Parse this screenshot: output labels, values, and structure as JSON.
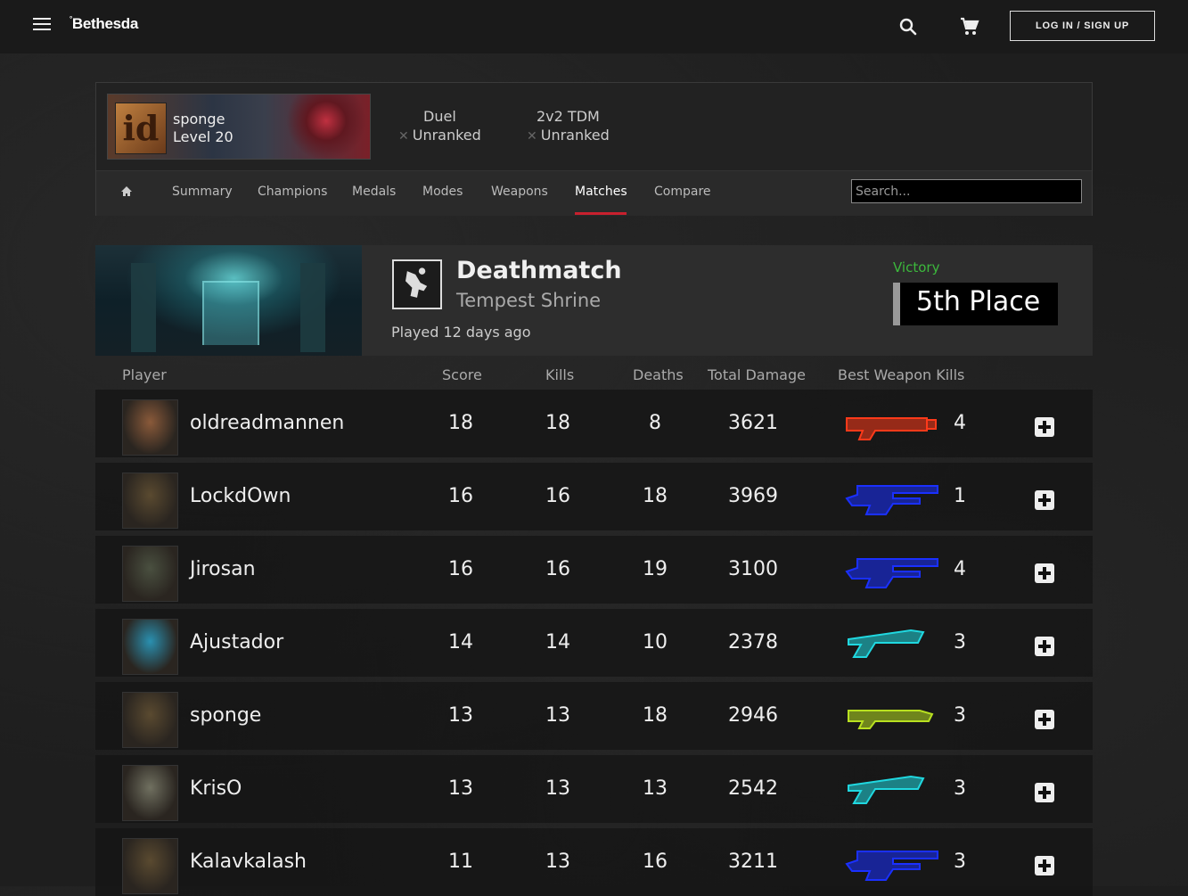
{
  "header": {
    "logo": "Bethesda",
    "logo_mark": "°",
    "login_label": "LOG IN / SIGN UP"
  },
  "profile": {
    "name": "sponge",
    "level": "Level 20",
    "ranks": [
      {
        "mode": "Duel",
        "status": "Unranked"
      },
      {
        "mode": "2v2 TDM",
        "status": "Unranked"
      }
    ]
  },
  "nav": {
    "items": [
      "Summary",
      "Champions",
      "Medals",
      "Modes",
      "Weapons",
      "Matches",
      "Compare"
    ],
    "active": "Matches",
    "search_placeholder": "Search..."
  },
  "match": {
    "mode": "Deathmatch",
    "map": "Tempest Shrine",
    "played": "Played 12 days ago",
    "result": "Victory",
    "place": "5th Place"
  },
  "columns": {
    "player": "Player",
    "score": "Score",
    "kills": "Kills",
    "deaths": "Deaths",
    "damage": "Total Damage",
    "best_weapon": "Best Weapon Kills"
  },
  "players": [
    {
      "name": "oldreadmannen",
      "score": "18",
      "kills": "18",
      "deaths": "8",
      "damage": "3621",
      "weapon": "rocket-launcher",
      "weapon_color": "#ff3a1a",
      "weapon_kills": "4",
      "avatar_color": "#8a5a3a"
    },
    {
      "name": "LockdOwn",
      "score": "16",
      "kills": "16",
      "deaths": "18",
      "damage": "3969",
      "weapon": "machine-gun",
      "weapon_color": "#1a30ff",
      "weapon_kills": "1",
      "avatar_color": "#5a4a30"
    },
    {
      "name": "Jirosan",
      "score": "16",
      "kills": "16",
      "deaths": "19",
      "damage": "3100",
      "weapon": "machine-gun",
      "weapon_color": "#1a30ff",
      "weapon_kills": "4",
      "avatar_color": "#4a5040"
    },
    {
      "name": "Ajustador",
      "score": "14",
      "kills": "14",
      "deaths": "10",
      "damage": "2378",
      "weapon": "nailgun",
      "weapon_color": "#20d8e0",
      "weapon_kills": "3",
      "avatar_color": "#2a90b0"
    },
    {
      "name": "sponge",
      "score": "13",
      "kills": "13",
      "deaths": "18",
      "damage": "2946",
      "weapon": "lightning-gun",
      "weapon_color": "#b8e020",
      "weapon_kills": "3",
      "avatar_color": "#5a4a30"
    },
    {
      "name": "KrisO",
      "score": "13",
      "kills": "13",
      "deaths": "13",
      "damage": "2542",
      "weapon": "nailgun",
      "weapon_color": "#20d8e0",
      "weapon_kills": "3",
      "avatar_color": "#707060"
    },
    {
      "name": "Kalavkalash",
      "score": "11",
      "kills": "13",
      "deaths": "16",
      "damage": "3211",
      "weapon": "machine-gun",
      "weapon_color": "#1a30ff",
      "weapon_kills": "3",
      "avatar_color": "#5a4a30"
    }
  ]
}
